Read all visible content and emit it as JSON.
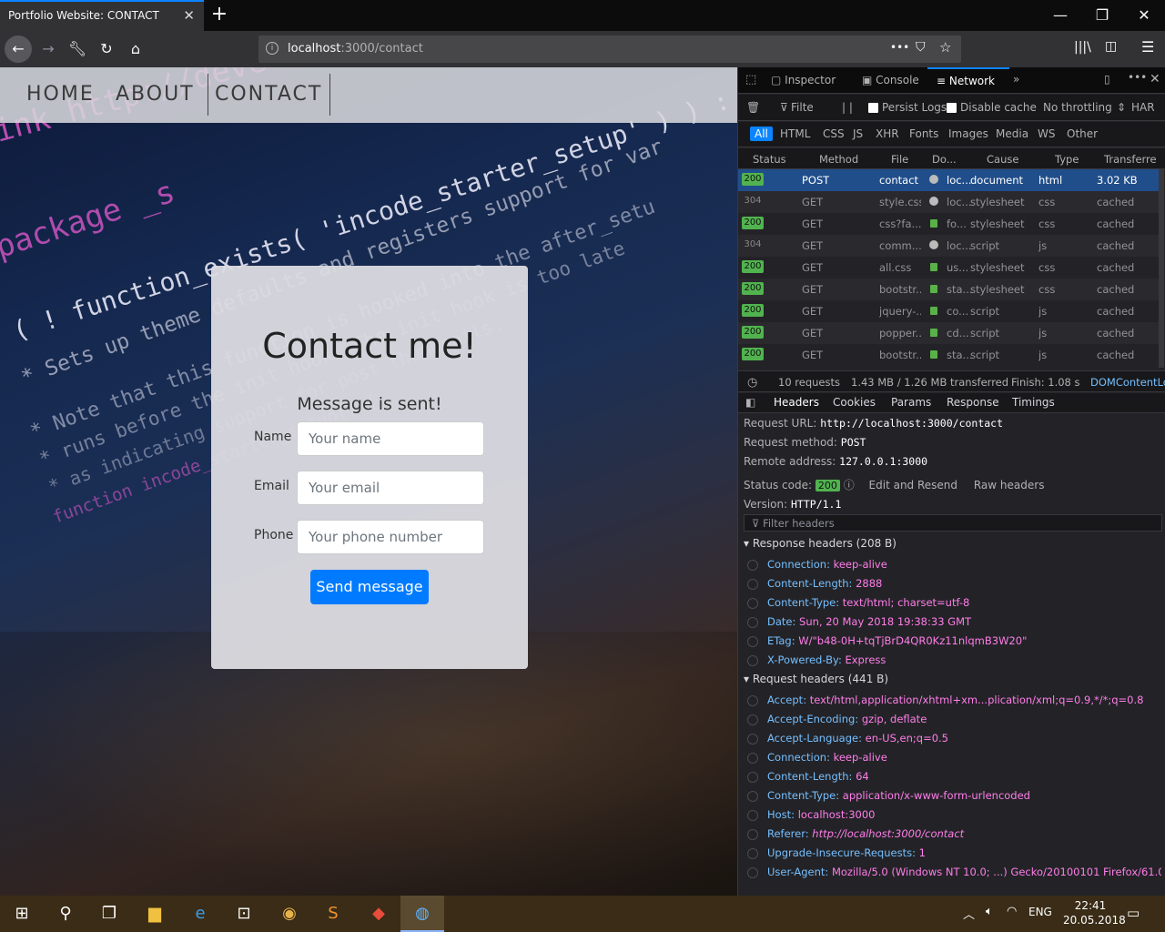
{
  "browser": {
    "tab_title": "Portfolio Website: CONTACT",
    "url_host": "localhost",
    "url_rest": ":3000/contact",
    "more_glyph": "•••"
  },
  "site": {
    "nav": [
      "HOME",
      "ABOUT",
      "CONTACT"
    ],
    "card": {
      "title": "Contact me!",
      "status": "Message is sent!",
      "fields": [
        {
          "label": "Name",
          "placeholder": "Your name"
        },
        {
          "label": "Email",
          "placeholder": "Your email"
        },
        {
          "label": "Phone",
          "placeholder": "Your phone number"
        }
      ],
      "submit": "Send message"
    },
    "background_code": [
      "ink http://devel",
      "package _s",
      "( ! function_exists( 'incode_starter_setup' ) ) :",
      "* Sets up theme defaults and registers support for var",
      "* Note that this function is hooked into the after_setu",
      "* runs before the init hook. The init hook is too late",
      "* as indicating support for post thumbnails.",
      "function incode_starter_setup() {"
    ]
  },
  "devtools": {
    "tabs": [
      "Inspector",
      "Console",
      "Network"
    ],
    "filter": {
      "placeholder": "Filter",
      "persist_logs": "Persist Logs",
      "disable_cache": "Disable cache",
      "throttling": "No throttling",
      "har": "HAR"
    },
    "types": [
      "All",
      "HTML",
      "CSS",
      "JS",
      "XHR",
      "Fonts",
      "Images",
      "Media",
      "WS",
      "Other"
    ],
    "columns": [
      "Status",
      "Method",
      "File",
      "Do...",
      "Cause",
      "Type",
      "Transferre"
    ],
    "requests": [
      {
        "status": "200",
        "method": "POST",
        "file": "contact",
        "domain": "loc...",
        "cause": "document",
        "type": "html",
        "transferred": "3.02 KB"
      },
      {
        "status": "304",
        "method": "GET",
        "file": "style.css",
        "domain": "loc...",
        "cause": "stylesheet",
        "type": "css",
        "transferred": "cached"
      },
      {
        "status": "200",
        "method": "GET",
        "file": "css?fa...",
        "domain": "fo...",
        "cause": "stylesheet",
        "type": "css",
        "transferred": "cached"
      },
      {
        "status": "304",
        "method": "GET",
        "file": "comm...",
        "domain": "loc...",
        "cause": "script",
        "type": "js",
        "transferred": "cached"
      },
      {
        "status": "200",
        "method": "GET",
        "file": "all.css",
        "domain": "us...",
        "cause": "stylesheet",
        "type": "css",
        "transferred": "cached"
      },
      {
        "status": "200",
        "method": "GET",
        "file": "bootstr...",
        "domain": "sta...",
        "cause": "stylesheet",
        "type": "css",
        "transferred": "cached"
      },
      {
        "status": "200",
        "method": "GET",
        "file": "jquery-...",
        "domain": "co...",
        "cause": "script",
        "type": "js",
        "transferred": "cached"
      },
      {
        "status": "200",
        "method": "GET",
        "file": "popper....",
        "domain": "cd...",
        "cause": "script",
        "type": "js",
        "transferred": "cached"
      },
      {
        "status": "200",
        "method": "GET",
        "file": "bootstr...",
        "domain": "sta...",
        "cause": "script",
        "type": "js",
        "transferred": "cached"
      }
    ],
    "summary": {
      "requests": "10 requests",
      "size": "1.43 MB / 1.26 MB transferred",
      "finish": "Finish: 1.08 s",
      "dom": "DOMContentLo"
    },
    "detail_tabs": [
      "Headers",
      "Cookies",
      "Params",
      "Response",
      "Timings"
    ],
    "request_url_label": "Request URL:",
    "request_url": "http://localhost:3000/contact",
    "request_method_label": "Request method:",
    "request_method": "POST",
    "remote_address_label": "Remote address:",
    "remote_address": "127.0.0.1:3000",
    "status_code_label": "Status code:",
    "status_code": "200",
    "edit_resend": "Edit and Resend",
    "raw_headers": "Raw headers",
    "version_label": "Version:",
    "version": "HTTP/1.1",
    "filter_headers": "Filter headers",
    "response_headers_title": "Response headers (208 B)",
    "response_headers": [
      {
        "name": "Connection:",
        "value": "keep-alive"
      },
      {
        "name": "Content-Length:",
        "value": "2888"
      },
      {
        "name": "Content-Type:",
        "value": "text/html; charset=utf-8"
      },
      {
        "name": "Date:",
        "value": "Sun, 20 May 2018 19:38:33 GMT"
      },
      {
        "name": "ETag:",
        "value": "W/\"b48-0H+tqTjBrD4QR0Kz11nlqmB3W20\""
      },
      {
        "name": "X-Powered-By:",
        "value": "Express"
      }
    ],
    "request_headers_title": "Request headers (441 B)",
    "request_headers": [
      {
        "name": "Accept:",
        "value": "text/html,application/xhtml+xm...plication/xml;q=0.9,*/*;q=0.8"
      },
      {
        "name": "Accept-Encoding:",
        "value": "gzip, deflate"
      },
      {
        "name": "Accept-Language:",
        "value": "en-US,en;q=0.5"
      },
      {
        "name": "Connection:",
        "value": "keep-alive"
      },
      {
        "name": "Content-Length:",
        "value": "64"
      },
      {
        "name": "Content-Type:",
        "value": "application/x-www-form-urlencoded"
      },
      {
        "name": "Host:",
        "value": "localhost:3000"
      },
      {
        "name": "Referer:",
        "value": "http://localhost:3000/contact"
      },
      {
        "name": "Upgrade-Insecure-Requests:",
        "value": "1"
      },
      {
        "name": "User-Agent:",
        "value": "Mozilla/5.0 (Windows NT 10.0; ...) Gecko/20100101 Firefox/61.0"
      }
    ]
  },
  "taskbar": {
    "lang": "ENG",
    "time": "22:41",
    "date": "20.05.2018"
  },
  "colors": {
    "accent": "#0a84ff",
    "button": "#007bff",
    "status_ok": "#51b34f",
    "header_name": "#75bfff",
    "header_value": "#ff7de9"
  }
}
